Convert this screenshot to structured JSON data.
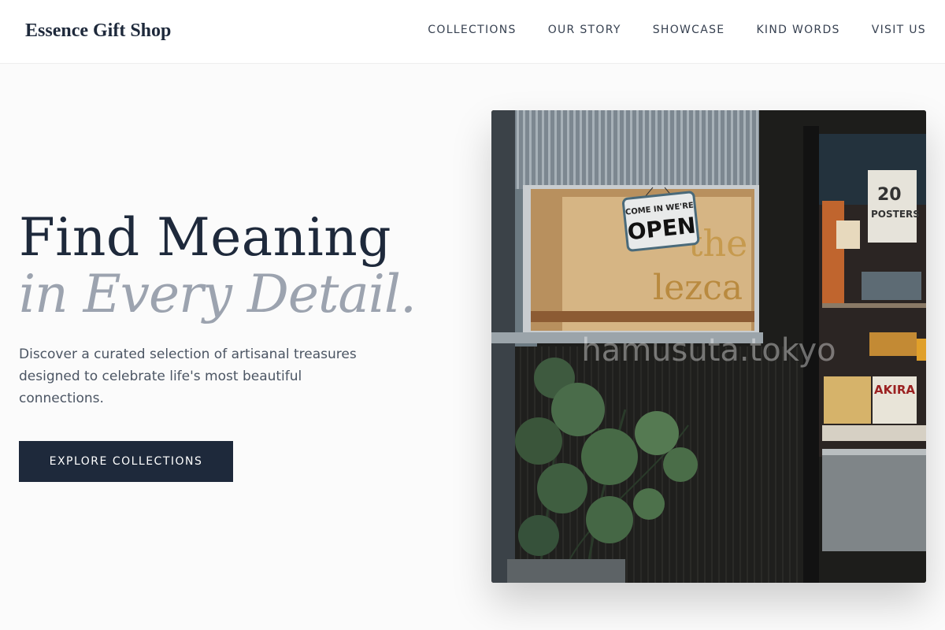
{
  "header": {
    "logo": "Essence Gift Shop",
    "nav": [
      "COLLECTIONS",
      "OUR STORY",
      "SHOWCASE",
      "KIND WORDS",
      "VISIT US"
    ]
  },
  "hero": {
    "title_line1": "Find Meaning",
    "title_line2": "in Every Detail.",
    "description": "Discover a curated selection of artisanal treasures designed to celebrate life's most beautiful connections.",
    "cta_label": "EXPLORE COLLECTIONS"
  },
  "image": {
    "sign_top": "COME IN WE'RE",
    "sign_main": "OPEN",
    "watermark": "hamusuta.tokyo",
    "poster_number": "20",
    "poster_word": "POSTERS",
    "book_word": "AKIRA"
  },
  "colors": {
    "ink": "#1e293b",
    "muted": "#9ca3af",
    "button": "#1e293b"
  }
}
